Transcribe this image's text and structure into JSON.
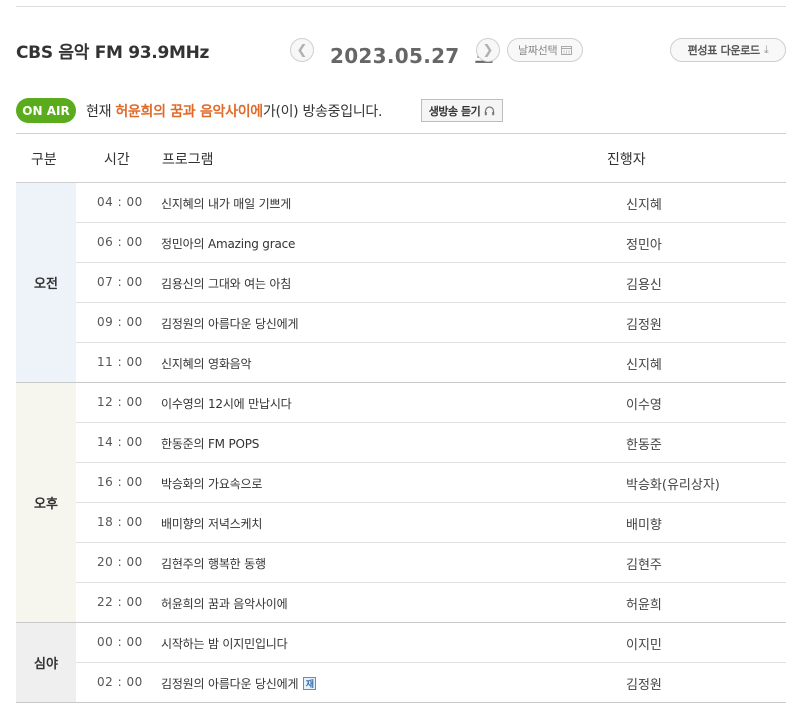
{
  "header": {
    "station": "CBS 음악 FM 93.9MHz",
    "date": "2023.05.27",
    "weekday": "토",
    "date_select_label": "날짜선택",
    "download_label": "편성표 다운로드"
  },
  "onair": {
    "badge": "ON AIR",
    "prefix": "현재",
    "program": "허윤희의 꿈과 음악사이에",
    "suffix": "가(이) 방송중입니다.",
    "listen_label": "생방송 듣기"
  },
  "table": {
    "headers": {
      "section": "구분",
      "time": "시간",
      "program": "프로그램",
      "host": "진행자"
    },
    "groups": [
      {
        "label": "오전",
        "rows": [
          {
            "time": "04 : 00",
            "program": "신지혜의 내가 매일 기쁘게",
            "host": "신지혜"
          },
          {
            "time": "06 : 00",
            "program": "정민아의 Amazing grace",
            "host": "정민아"
          },
          {
            "time": "07 : 00",
            "program": "김용신의 그대와 여는 아침",
            "host": "김용신"
          },
          {
            "time": "09 : 00",
            "program": "김정원의 아름다운 당신에게",
            "host": "김정원"
          },
          {
            "time": "11 : 00",
            "program": "신지혜의 영화음악",
            "host": "신지혜"
          }
        ]
      },
      {
        "label": "오후",
        "rows": [
          {
            "time": "12 : 00",
            "program": "이수영의 12시에 만납시다",
            "host": "이수영"
          },
          {
            "time": "14 : 00",
            "program": "한동준의 FM POPS",
            "host": "한동준"
          },
          {
            "time": "16 : 00",
            "program": "박승화의 가요속으로",
            "host": "박승화(유리상자)"
          },
          {
            "time": "18 : 00",
            "program": "배미향의 저녁스케치",
            "host": "배미향"
          },
          {
            "time": "20 : 00",
            "program": "김현주의 행복한 동행",
            "host": "김현주"
          },
          {
            "time": "22 : 00",
            "program": "허윤희의 꿈과 음악사이에",
            "host": "허윤희"
          }
        ]
      },
      {
        "label": "심야",
        "rows": [
          {
            "time": "00 : 00",
            "program": "시작하는 밤 이지민입니다",
            "host": "이지민"
          },
          {
            "time": "02 : 00",
            "program": "김정원의 아름다운 당신에게",
            "host": "김정원",
            "rerun_badge": "재"
          }
        ]
      }
    ]
  }
}
